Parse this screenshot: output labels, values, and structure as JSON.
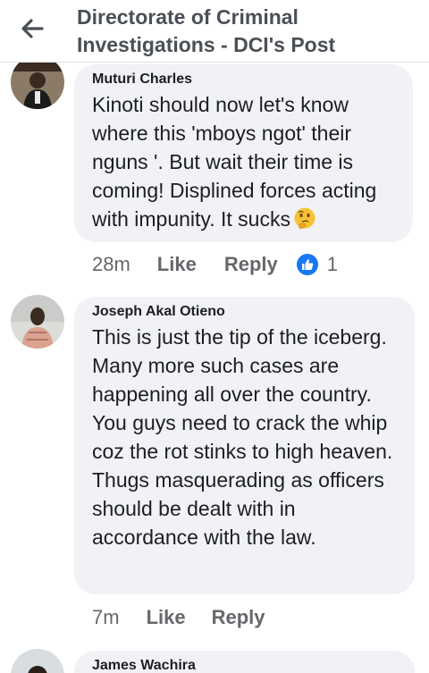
{
  "header": {
    "title": "Directorate of Criminal Investigations - DCI's Post"
  },
  "comments": [
    {
      "author": "Muturi Charles",
      "text": "Kinoti should now let's know where this 'mboys ngot' their nguns '. But wait their time is coming! Displined forces acting with impunity. It sucks",
      "emoji": "thinking-face",
      "time": "28m",
      "like_label": "Like",
      "reply_label": "Reply",
      "reaction_count": "1"
    },
    {
      "author": "Joseph Akal Otieno",
      "text": "This is just the tip of the iceberg. Many more such cases are happening all over the country. You guys need to crack the whip coz the rot stinks to high heaven. Thugs masquerading as officers should be dealt with in accordance with the law.",
      "time": "7m",
      "like_label": "Like",
      "reply_label": "Reply"
    },
    {
      "author": "James Wachira"
    }
  ],
  "colors": {
    "bubble": "#f0f2f5",
    "meta_text": "#65676b",
    "like_reaction": "#1877f2"
  }
}
